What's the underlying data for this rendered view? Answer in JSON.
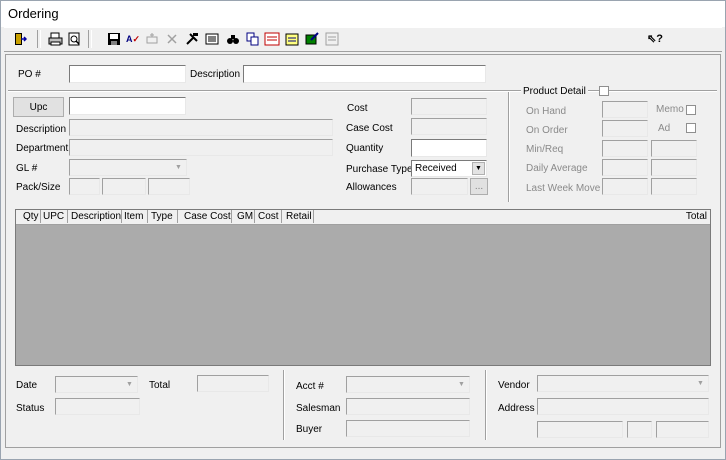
{
  "window": {
    "title": "Ordering"
  },
  "toolbar": {
    "icons": [
      "exit-icon",
      "print-icon",
      "print-preview-icon",
      "save-icon",
      "spell-check-icon",
      "add-item-icon",
      "delete-item-icon",
      "tools-icon",
      "details-icon",
      "find-icon",
      "copy-icon",
      "import-icon",
      "notes-icon",
      "edit-icon",
      "list-icon",
      "help-icon"
    ]
  },
  "header": {
    "po_label": "PO #",
    "po_value": "",
    "description_label": "Description",
    "description_value": ""
  },
  "item": {
    "upc_button": "Upc",
    "upc_value": "",
    "description_label": "Description",
    "department_label": "Department",
    "gl_label": "GL #",
    "pack_size_label": "Pack/Size"
  },
  "pricing": {
    "cost_label": "Cost",
    "case_cost_label": "Case Cost",
    "quantity_label": "Quantity",
    "quantity_value": "",
    "purchase_type_label": "Purchase Type",
    "purchase_type_value": "Received",
    "allowances_label": "Allowances",
    "allowances_button": "..."
  },
  "product_detail": {
    "title": "Product Detail",
    "on_hand_label": "On Hand",
    "on_order_label": "On Order",
    "min_req_label": "Min/Req",
    "daily_average_label": "Daily Average",
    "last_week_move_label": "Last Week Move",
    "memo_label": "Memo",
    "ad_label": "Ad"
  },
  "grid": {
    "columns": [
      "Qty",
      "UPC",
      "Description",
      "Item",
      "Type",
      "Case Cost",
      "GM",
      "Cost",
      "Retail",
      "Total"
    ],
    "rows": []
  },
  "footer": {
    "date_label": "Date",
    "total_label": "Total",
    "status_label": "Status",
    "acct_label": "Acct #",
    "salesman_label": "Salesman",
    "buyer_label": "Buyer",
    "vendor_label": "Vendor",
    "address_label": "Address"
  }
}
